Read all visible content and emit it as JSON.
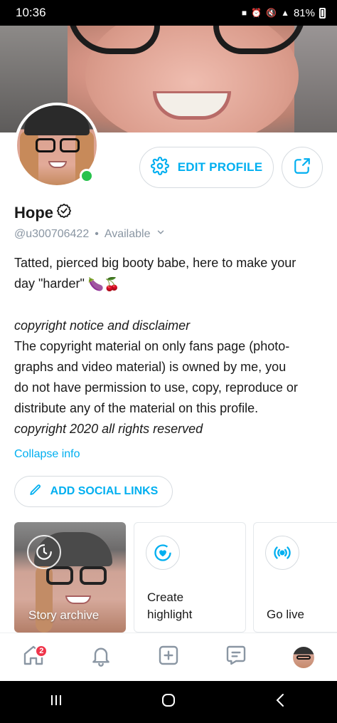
{
  "status_bar": {
    "time": "10:36",
    "battery": "81%",
    "icons": [
      "lock-icon",
      "alarm-icon",
      "mute-icon",
      "signal-icon",
      "battery-icon"
    ]
  },
  "profile": {
    "name": "Hope",
    "handle": "@u300706422",
    "separator": "•",
    "availability": "Available",
    "online": true,
    "edit_label": "EDIT PROFILE"
  },
  "bio": {
    "line1": "Tatted, pierced big booty babe, here to make your",
    "line2_text": "day \"harder\"",
    "line2_emoji": "🍆🍒",
    "notice_title": "copyright notice and disclaimer",
    "notice_lines": [
      "The copyright material on only fans page (photo-",
      "graphs and video material) is owned by me, you",
      "do not have permission to use, copy, reproduce or",
      "distribute any of the material on this profile."
    ],
    "footer": "copyright 2020 all rights reserved"
  },
  "collapse_label": "Collapse info",
  "social_button": "ADD SOCIAL LINKS",
  "highlights": {
    "story_archive": "Story archive",
    "create_line1": "Create",
    "create_line2": "highlight",
    "go_live": "Go live"
  },
  "nav": {
    "notification_badge": "2"
  },
  "colors": {
    "accent": "#00aff0",
    "online": "#27c24c",
    "badge": "#f0354b",
    "muted": "#8a96a3"
  }
}
